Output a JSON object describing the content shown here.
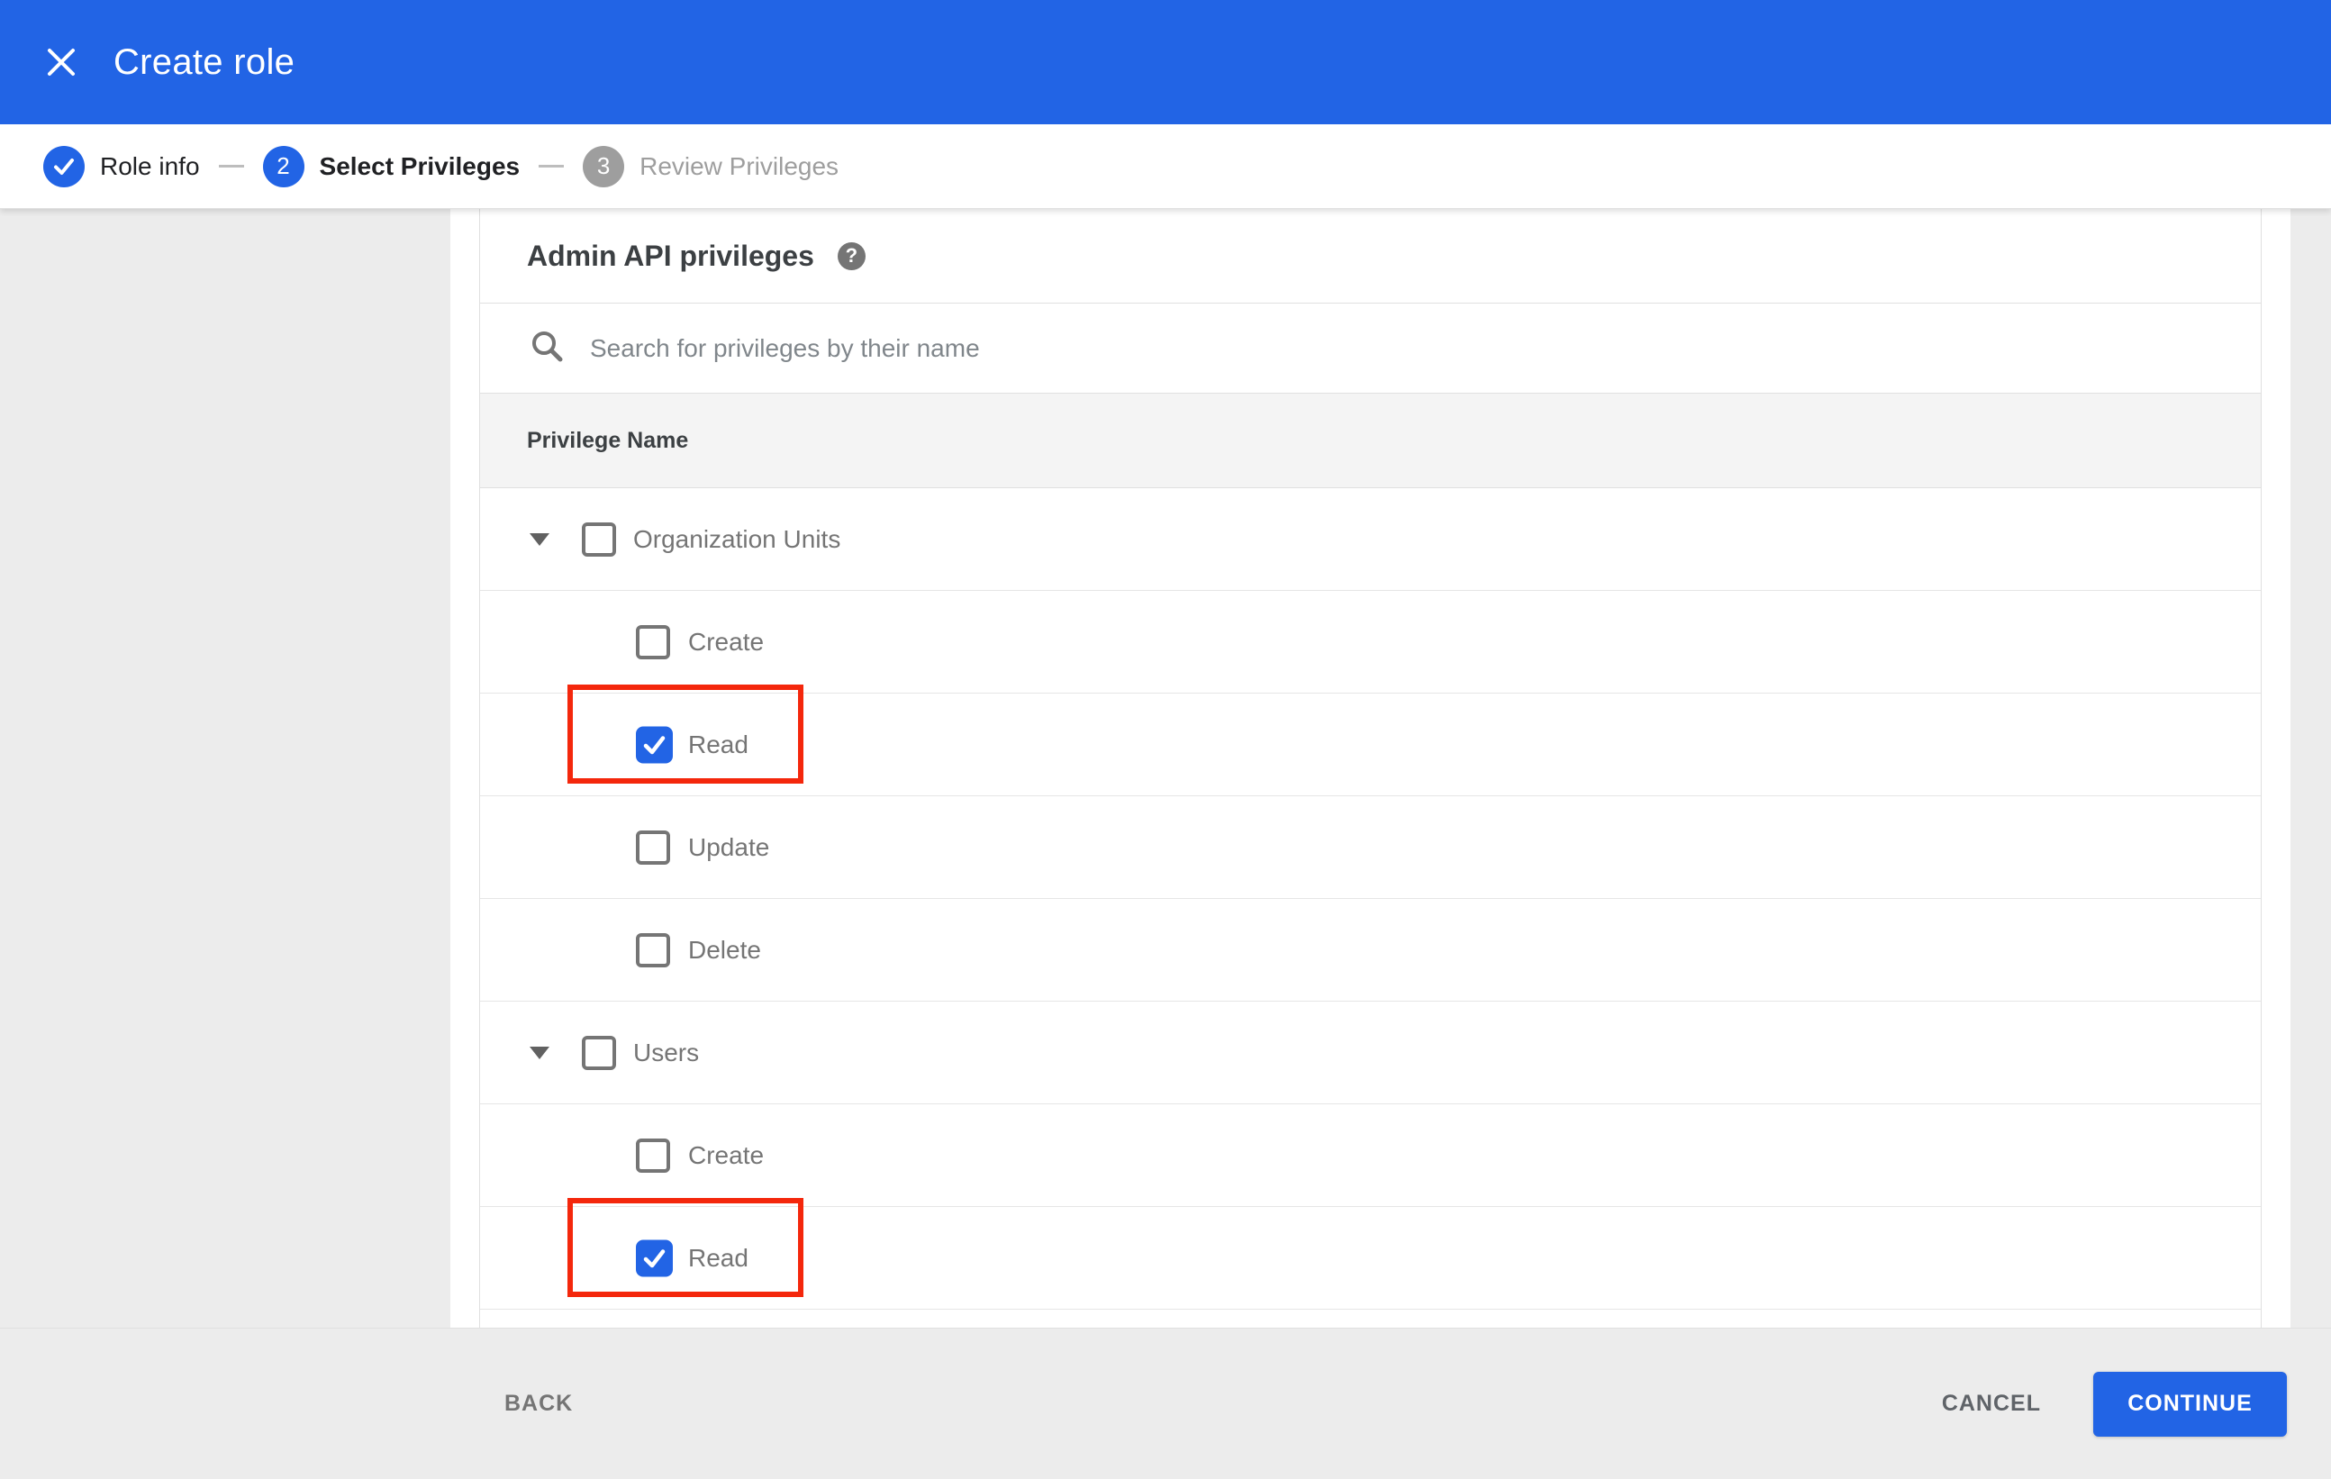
{
  "appbar": {
    "title": "Create role"
  },
  "stepper": {
    "steps": [
      {
        "number": "1",
        "label": "Role info",
        "state": "completed"
      },
      {
        "number": "2",
        "label": "Select Privileges",
        "state": "active"
      },
      {
        "number": "3",
        "label": "Review Privileges",
        "state": "upcoming"
      }
    ]
  },
  "content": {
    "section_title": "Admin API privileges",
    "help_icon": "help-icon",
    "search": {
      "placeholder": "Search for privileges by their name",
      "value": ""
    },
    "table": {
      "header": "Privilege Name",
      "rows": [
        {
          "type": "group",
          "label": "Organization Units",
          "checked": false,
          "highlighted": false
        },
        {
          "type": "child",
          "label": "Create",
          "checked": false,
          "highlighted": false
        },
        {
          "type": "child",
          "label": "Read",
          "checked": true,
          "highlighted": true
        },
        {
          "type": "child",
          "label": "Update",
          "checked": false,
          "highlighted": false
        },
        {
          "type": "child",
          "label": "Delete",
          "checked": false,
          "highlighted": false
        },
        {
          "type": "group",
          "label": "Users",
          "checked": false,
          "highlighted": false
        },
        {
          "type": "child",
          "label": "Create",
          "checked": false,
          "highlighted": false
        },
        {
          "type": "child",
          "label": "Read",
          "checked": true,
          "highlighted": true
        }
      ]
    }
  },
  "footer": {
    "back_label": "BACK",
    "cancel_label": "CANCEL",
    "continue_label": "CONTINUE"
  },
  "colors": {
    "accent_blue": "#2264e5",
    "highlight_red": "#f4270c",
    "inactive_step_gray": "#9e9e9e",
    "page_background": "#ececec"
  }
}
